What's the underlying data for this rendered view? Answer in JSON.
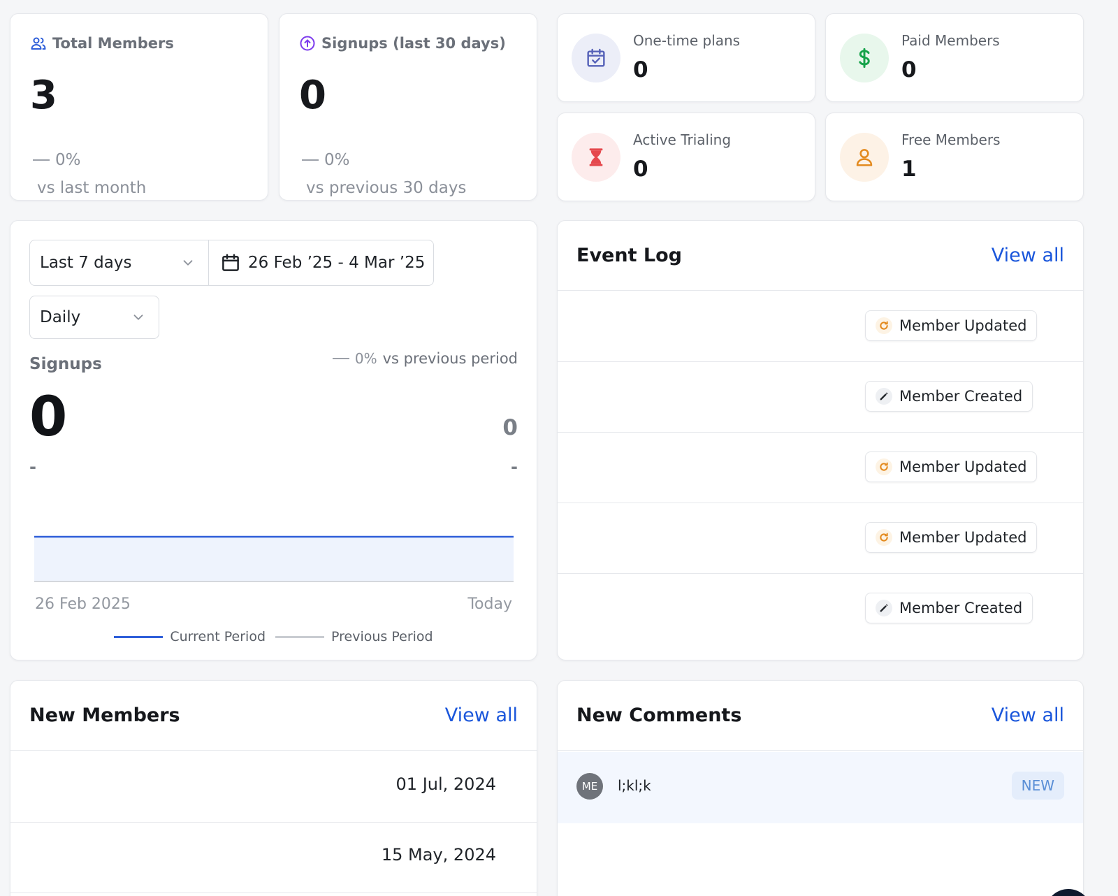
{
  "stats": {
    "total_members": {
      "label": "Total Members",
      "value": "3",
      "change": "0%",
      "compare": "vs last month"
    },
    "signups": {
      "label": "Signups (last 30 days)",
      "value": "0",
      "change": "0%",
      "compare": "vs previous 30 days"
    }
  },
  "mini_stats": [
    {
      "label": "One-time plans",
      "value": "0",
      "icon": "calendar-check-icon",
      "color": "#5561b8",
      "bg": "#eceef8"
    },
    {
      "label": "Paid Members",
      "value": "0",
      "icon": "dollar-icon",
      "color": "#16a34a",
      "bg": "#e8f7ec"
    },
    {
      "label": "Active Trialing",
      "value": "0",
      "icon": "hourglass-icon",
      "color": "#e5484d",
      "bg": "#fdecec"
    },
    {
      "label": "Free Members",
      "value": "1",
      "icon": "user-icon",
      "color": "#e38a1e",
      "bg": "#fdf2e6"
    }
  ],
  "chart_card": {
    "range_select": "Last 7 days",
    "date_range": "26 Feb ’25 - 4 Mar ’25",
    "interval_select": "Daily",
    "metric_title": "Signups",
    "metric_change": "0%",
    "metric_compare": "vs previous period",
    "metric_value": "0",
    "previous_value": "0",
    "sub_left": "-",
    "sub_right": "-",
    "x_start": "26 Feb 2025",
    "x_end": "Today",
    "legend_current": "Current Period",
    "legend_previous": "Previous Period",
    "current_color": "#2f5fd9",
    "previous_color": "#c9ccd1"
  },
  "chart_data": {
    "type": "area",
    "title": "",
    "x": [
      "26 Feb 2025",
      "Today"
    ],
    "series": [
      {
        "name": "Current Period",
        "values": [
          0,
          0
        ]
      },
      {
        "name": "Previous Period",
        "values": [
          0,
          0
        ]
      }
    ],
    "xlabel": "",
    "ylabel": "",
    "grid": false,
    "legend": "bottom"
  },
  "event_log": {
    "title": "Event Log",
    "view_all": "View all",
    "events": [
      {
        "label": "Member Updated",
        "icon": "refresh-icon"
      },
      {
        "label": "Member Created",
        "icon": "pencil-icon"
      },
      {
        "label": "Member Updated",
        "icon": "refresh-icon"
      },
      {
        "label": "Member Updated",
        "icon": "refresh-icon"
      },
      {
        "label": "Member Created",
        "icon": "pencil-icon"
      }
    ]
  },
  "new_members": {
    "title": "New Members",
    "view_all": "View all",
    "rows": [
      {
        "date": "01 Jul, 2024"
      },
      {
        "date": "15 May, 2024"
      }
    ]
  },
  "new_comments": {
    "title": "New Comments",
    "view_all": "View all",
    "comments": [
      {
        "initials": "ME",
        "text": "l;kl;k",
        "badge": "NEW"
      }
    ]
  }
}
